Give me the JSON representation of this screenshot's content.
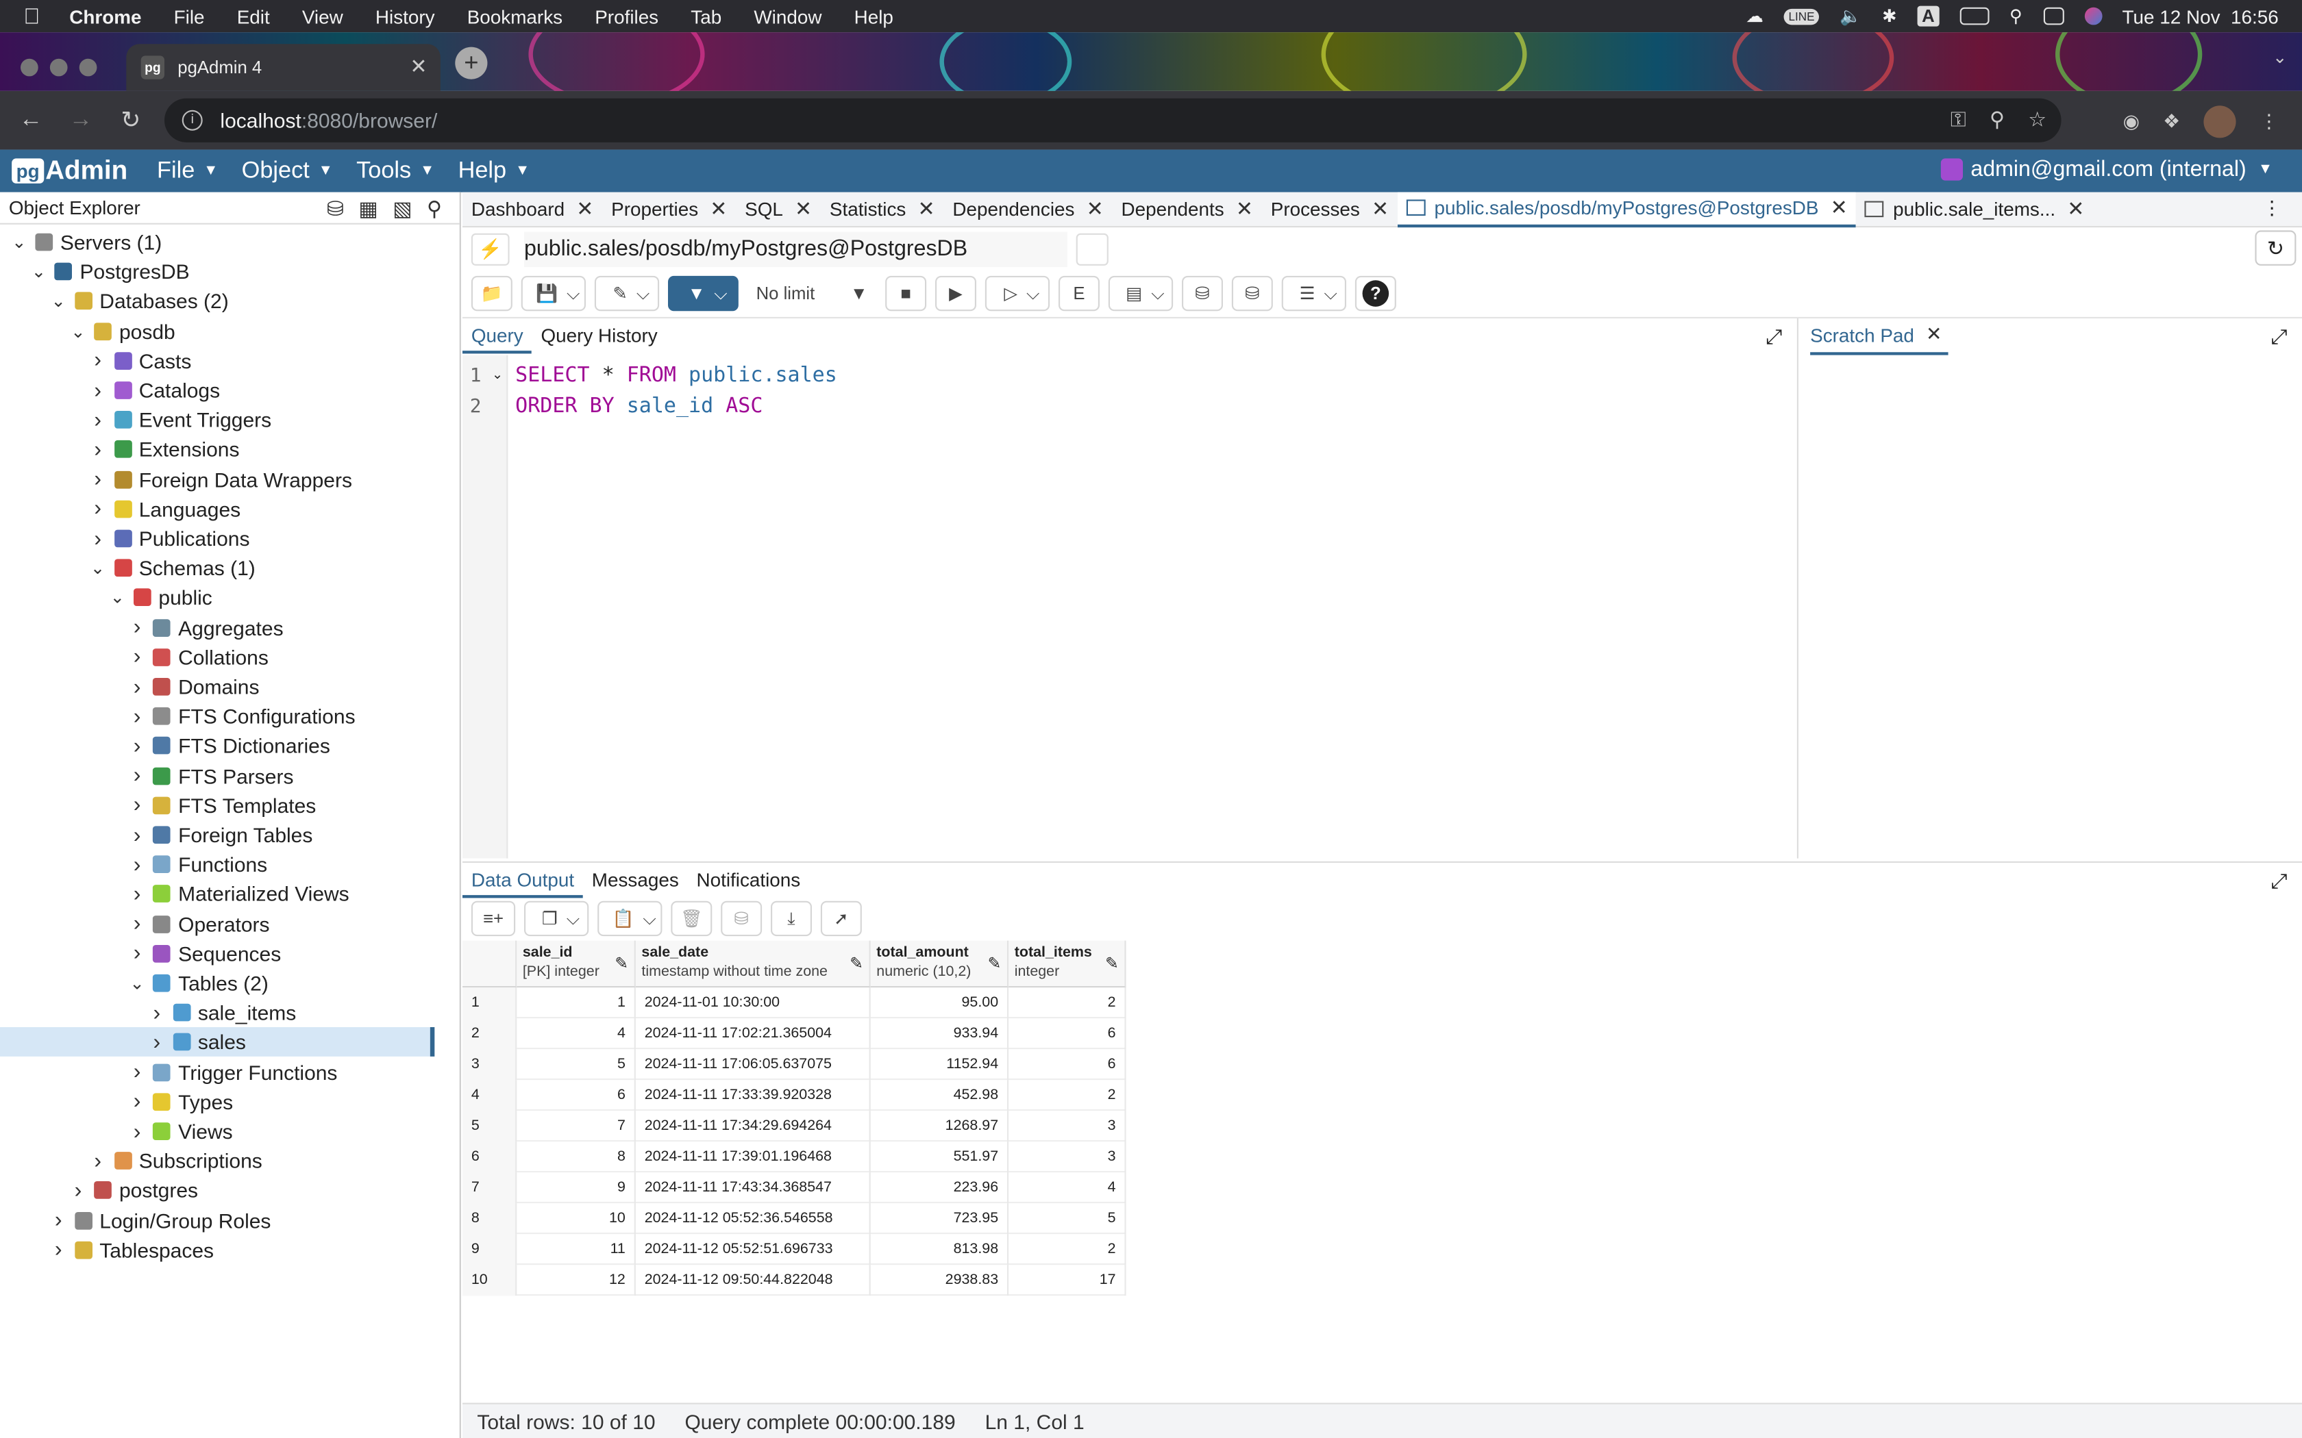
{
  "macos": {
    "menu": [
      "Chrome",
      "File",
      "Edit",
      "View",
      "History",
      "Bookmarks",
      "Profiles",
      "Tab",
      "Window",
      "Help"
    ],
    "clock": "Tue 12 Nov  16:56",
    "status_glyphs": [
      "LINE",
      "A"
    ]
  },
  "browser": {
    "tab_title": "pgAdmin 4",
    "tab_favicon": "pg",
    "url_host": "localhost",
    "url_path": ":8080/browser/"
  },
  "pgadmin": {
    "logo_pg": "pg",
    "logo_admin": "Admin",
    "menu": [
      "File",
      "Object",
      "Tools",
      "Help"
    ],
    "user": "admin@gmail.com (internal)"
  },
  "explorer": {
    "title": "Object Explorer",
    "tree": [
      {
        "label": "Servers (1)",
        "depth": 0,
        "expanded": true,
        "icon": "servers-icon",
        "color": "#888"
      },
      {
        "label": "PostgresDB",
        "depth": 1,
        "expanded": true,
        "icon": "elephant-icon",
        "color": "#336791"
      },
      {
        "label": "Databases (2)",
        "depth": 2,
        "expanded": true,
        "icon": "database-icon",
        "color": "#d6b23c"
      },
      {
        "label": "posdb",
        "depth": 3,
        "expanded": true,
        "icon": "database-icon",
        "color": "#d6b23c"
      },
      {
        "label": "Casts",
        "depth": 4,
        "expanded": false,
        "icon": "casts-icon",
        "color": "#7b5fc9"
      },
      {
        "label": "Catalogs",
        "depth": 4,
        "expanded": false,
        "icon": "catalogs-icon",
        "color": "#a05bd0"
      },
      {
        "label": "Event Triggers",
        "depth": 4,
        "expanded": false,
        "icon": "event-triggers-icon",
        "color": "#4aa3c7"
      },
      {
        "label": "Extensions",
        "depth": 4,
        "expanded": false,
        "icon": "extensions-icon",
        "color": "#3c9a4a"
      },
      {
        "label": "Foreign Data Wrappers",
        "depth": 4,
        "expanded": false,
        "icon": "fdw-icon",
        "color": "#b38b2e"
      },
      {
        "label": "Languages",
        "depth": 4,
        "expanded": false,
        "icon": "languages-icon",
        "color": "#e5c72f"
      },
      {
        "label": "Publications",
        "depth": 4,
        "expanded": false,
        "icon": "publications-icon",
        "color": "#5b6cb7"
      },
      {
        "label": "Schemas (1)",
        "depth": 4,
        "expanded": true,
        "icon": "schemas-icon",
        "color": "#d64545"
      },
      {
        "label": "public",
        "depth": 5,
        "expanded": true,
        "icon": "schema-icon",
        "color": "#d64545"
      },
      {
        "label": "Aggregates",
        "depth": 6,
        "expanded": false,
        "icon": "aggregates-icon",
        "color": "#6c8a9c"
      },
      {
        "label": "Collations",
        "depth": 6,
        "expanded": false,
        "icon": "collations-icon",
        "color": "#d05050"
      },
      {
        "label": "Domains",
        "depth": 6,
        "expanded": false,
        "icon": "domains-icon",
        "color": "#c0504d"
      },
      {
        "label": "FTS Configurations",
        "depth": 6,
        "expanded": false,
        "icon": "fts-config-icon",
        "color": "#8c8c8c"
      },
      {
        "label": "FTS Dictionaries",
        "depth": 6,
        "expanded": false,
        "icon": "fts-dictionaries-icon",
        "color": "#4f79a6"
      },
      {
        "label": "FTS Parsers",
        "depth": 6,
        "expanded": false,
        "icon": "fts-parsers-icon",
        "color": "#3c9a4a"
      },
      {
        "label": "FTS Templates",
        "depth": 6,
        "expanded": false,
        "icon": "fts-templates-icon",
        "color": "#d6b23c"
      },
      {
        "label": "Foreign Tables",
        "depth": 6,
        "expanded": false,
        "icon": "foreign-tables-icon",
        "color": "#4f79a6"
      },
      {
        "label": "Functions",
        "depth": 6,
        "expanded": false,
        "icon": "functions-icon",
        "color": "#7aa6c9"
      },
      {
        "label": "Materialized Views",
        "depth": 6,
        "expanded": false,
        "icon": "materialized-views-icon",
        "color": "#8ccf3a"
      },
      {
        "label": "Operators",
        "depth": 6,
        "expanded": false,
        "icon": "operators-icon",
        "color": "#888"
      },
      {
        "label": "Sequences",
        "depth": 6,
        "expanded": false,
        "icon": "sequences-icon",
        "color": "#9a55c0"
      },
      {
        "label": "Tables (2)",
        "depth": 6,
        "expanded": true,
        "icon": "tables-icon",
        "color": "#4f9bd0"
      },
      {
        "label": "sale_items",
        "depth": 7,
        "expanded": false,
        "icon": "table-icon",
        "color": "#4f9bd0"
      },
      {
        "label": "sales",
        "depth": 7,
        "expanded": false,
        "icon": "table-icon",
        "color": "#4f9bd0",
        "selected": true
      },
      {
        "label": "Trigger Functions",
        "depth": 6,
        "expanded": false,
        "icon": "trigger-functions-icon",
        "color": "#7aa6c9"
      },
      {
        "label": "Types",
        "depth": 6,
        "expanded": false,
        "icon": "types-icon",
        "color": "#e5c72f"
      },
      {
        "label": "Views",
        "depth": 6,
        "expanded": false,
        "icon": "views-icon",
        "color": "#8ccf3a"
      },
      {
        "label": "Subscriptions",
        "depth": 4,
        "expanded": false,
        "icon": "subscriptions-icon",
        "color": "#e0934a"
      },
      {
        "label": "postgres",
        "depth": 3,
        "expanded": false,
        "icon": "database-icon",
        "color": "#c0504d"
      },
      {
        "label": "Login/Group Roles",
        "depth": 2,
        "expanded": false,
        "icon": "roles-icon",
        "color": "#888"
      },
      {
        "label": "Tablespaces",
        "depth": 2,
        "expanded": false,
        "icon": "tablespaces-icon",
        "color": "#d6b23c"
      }
    ]
  },
  "main_tabs": [
    {
      "label": "Dashboard"
    },
    {
      "label": "Properties"
    },
    {
      "label": "SQL"
    },
    {
      "label": "Statistics"
    },
    {
      "label": "Dependencies"
    },
    {
      "label": "Dependents"
    },
    {
      "label": "Processes"
    },
    {
      "label": "public.sales/posdb/myPostgres@PostgresDB",
      "active": true,
      "table": true
    },
    {
      "label": "public.sale_items...",
      "table": true
    }
  ],
  "query_tool": {
    "connection": "public.sales/posdb/myPostgres@PostgresDB",
    "limit": "No limit",
    "editor_tabs": [
      "Query",
      "Query History"
    ],
    "scratch_pad": "Scratch Pad",
    "code": {
      "l1_num": "1",
      "l2_num": "2",
      "l1_kw1": "SELECT",
      "l1_star": " * ",
      "l1_kw2": "FROM",
      "l1_tbl": " public.sales",
      "l2_kw1": "ORDER BY",
      "l2_col": " sale_id",
      "l2_kw2": " ASC"
    }
  },
  "results": {
    "tabs": [
      "Data Output",
      "Messages",
      "Notifications"
    ],
    "columns": [
      {
        "name": "sale_id",
        "type": "[PK] integer"
      },
      {
        "name": "sale_date",
        "type": "timestamp without time zone"
      },
      {
        "name": "total_amount",
        "type": "numeric (10,2)"
      },
      {
        "name": "total_items",
        "type": "integer"
      }
    ],
    "rows": [
      [
        "1",
        "1",
        "2024-11-01 10:30:00",
        "95.00",
        "2"
      ],
      [
        "2",
        "4",
        "2024-11-11 17:02:21.365004",
        "933.94",
        "6"
      ],
      [
        "3",
        "5",
        "2024-11-11 17:06:05.637075",
        "1152.94",
        "6"
      ],
      [
        "4",
        "6",
        "2024-11-11 17:33:39.920328",
        "452.98",
        "2"
      ],
      [
        "5",
        "7",
        "2024-11-11 17:34:29.694264",
        "1268.97",
        "3"
      ],
      [
        "6",
        "8",
        "2024-11-11 17:39:01.196468",
        "551.97",
        "3"
      ],
      [
        "7",
        "9",
        "2024-11-11 17:43:34.368547",
        "223.96",
        "4"
      ],
      [
        "8",
        "10",
        "2024-11-12 05:52:36.546558",
        "723.95",
        "5"
      ],
      [
        "9",
        "11",
        "2024-11-12 05:52:51.696733",
        "813.98",
        "2"
      ],
      [
        "10",
        "12",
        "2024-11-12 09:50:44.822048",
        "2938.83",
        "17"
      ]
    ]
  },
  "status": {
    "rows": "Total rows: 10 of 10",
    "query": "Query complete 00:00:00.189",
    "pos": "Ln 1, Col 1"
  }
}
